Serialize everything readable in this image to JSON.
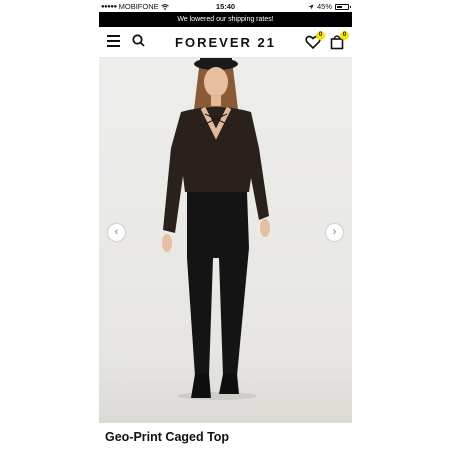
{
  "status_bar": {
    "carrier": "MOBIFONE",
    "time": "15:40",
    "battery": "45%",
    "battery_level": 0.45
  },
  "promo_banner": {
    "text": "We lowered our shipping rates!"
  },
  "header": {
    "logo": "FOREVER 21",
    "wishlist_count": "0",
    "bag_count": "0"
  },
  "product": {
    "title": "Geo-Print Caged Top"
  },
  "icons": [
    "menu-icon",
    "search-icon",
    "heart-icon",
    "bag-icon",
    "chevron-left-icon",
    "chevron-right-icon"
  ],
  "colors": {
    "banner_bg": "#000000",
    "badge": "#f6e600",
    "text": "#111111"
  }
}
